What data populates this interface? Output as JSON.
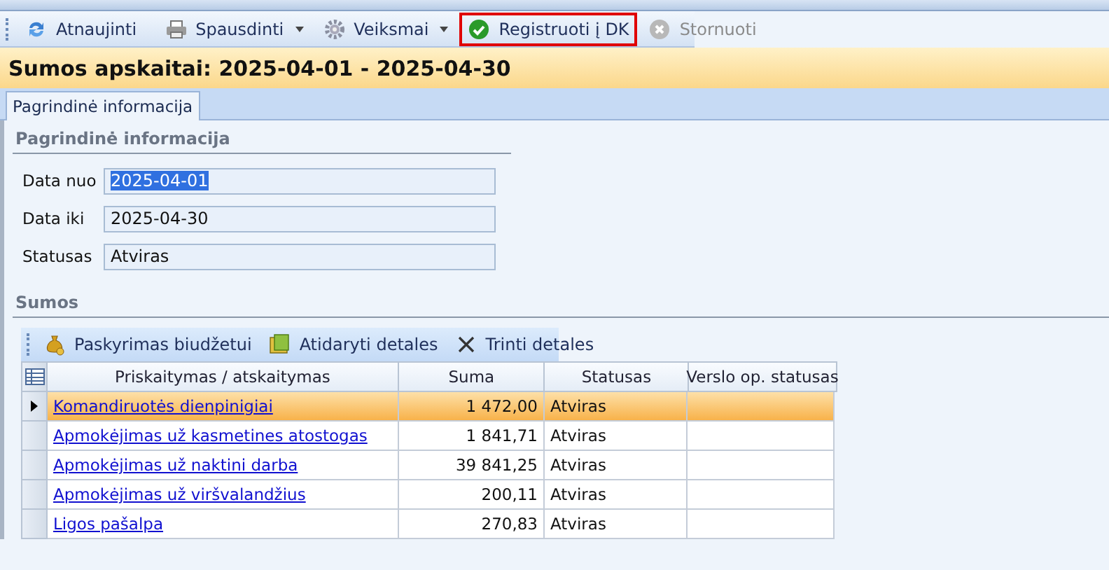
{
  "toolbar": [
    {
      "label": "Atnaujinti",
      "kind": "refresh",
      "dropdown": false,
      "disabled": false,
      "highlighted": false
    },
    {
      "label": "Spausdinti",
      "kind": "print",
      "dropdown": true,
      "disabled": false,
      "highlighted": false
    },
    {
      "label": "Veiksmai",
      "kind": "gear",
      "dropdown": true,
      "disabled": false,
      "highlighted": false
    },
    {
      "label": "Registruoti į DK",
      "kind": "check",
      "dropdown": false,
      "disabled": false,
      "highlighted": true
    },
    {
      "label": "Stornuoti",
      "kind": "cancel",
      "dropdown": false,
      "disabled": true,
      "highlighted": false
    }
  ],
  "title": "Sumos apskaitai: 2025-04-01 - 2025-04-30",
  "tabs": [
    {
      "label": "Pagrindinė informacija",
      "selected": true
    }
  ],
  "info_section": {
    "title": "Pagrindinė informacija",
    "fields": [
      {
        "label": "Data nuo",
        "value": "2025-04-01",
        "selected_text": true
      },
      {
        "label": "Data iki",
        "value": "2025-04-30",
        "selected_text": false
      },
      {
        "label": "Statusas",
        "value": "Atviras",
        "selected_text": false
      }
    ]
  },
  "sums_section": {
    "title": "Sumos",
    "toolbar": [
      {
        "label": "Paskyrimas biudžetui",
        "kind": "moneybag"
      },
      {
        "label": "Atidaryti detales",
        "kind": "open"
      },
      {
        "label": "Trinti detales",
        "kind": "delete"
      }
    ],
    "table": {
      "columns": [
        "Priskaitymas / atskaitymas",
        "Suma",
        "Statusas",
        "Verslo op. statusas"
      ],
      "rows": [
        {
          "name": "Komandiruotės dienpinigiai",
          "sum": "1 472,00",
          "status": "Atviras",
          "selected": true
        },
        {
          "name": "Apmokėjimas už kasmetines atostogas",
          "sum": "1 841,71",
          "status": "Atviras",
          "selected": false
        },
        {
          "name": "Apmokėjimas už naktini darba",
          "sum": "39 841,25",
          "status": "Atviras",
          "selected": false
        },
        {
          "name": "Apmokėjimas už viršvalandžius",
          "sum": "200,11",
          "status": "Atviras",
          "selected": false
        },
        {
          "name": "Ligos pašalpa",
          "sum": "270,83",
          "status": "Atviras",
          "selected": false
        }
      ]
    }
  }
}
